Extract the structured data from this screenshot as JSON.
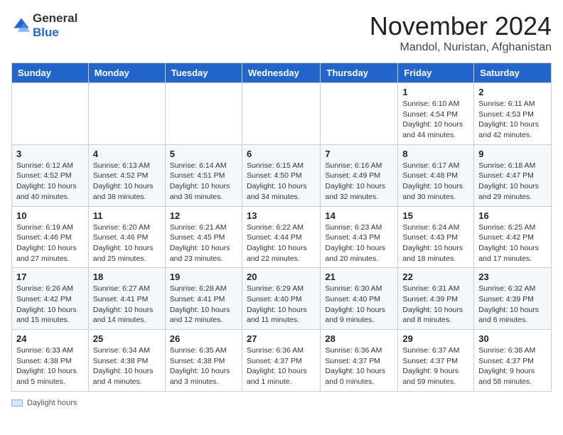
{
  "header": {
    "logo_general": "General",
    "logo_blue": "Blue",
    "month_title": "November 2024",
    "location": "Mandol, Nuristan, Afghanistan"
  },
  "columns": [
    "Sunday",
    "Monday",
    "Tuesday",
    "Wednesday",
    "Thursday",
    "Friday",
    "Saturday"
  ],
  "weeks": [
    [
      {
        "day": "",
        "info": ""
      },
      {
        "day": "",
        "info": ""
      },
      {
        "day": "",
        "info": ""
      },
      {
        "day": "",
        "info": ""
      },
      {
        "day": "",
        "info": ""
      },
      {
        "day": "1",
        "info": "Sunrise: 6:10 AM\nSunset: 4:54 PM\nDaylight: 10 hours and 44 minutes."
      },
      {
        "day": "2",
        "info": "Sunrise: 6:11 AM\nSunset: 4:53 PM\nDaylight: 10 hours and 42 minutes."
      }
    ],
    [
      {
        "day": "3",
        "info": "Sunrise: 6:12 AM\nSunset: 4:52 PM\nDaylight: 10 hours and 40 minutes."
      },
      {
        "day": "4",
        "info": "Sunrise: 6:13 AM\nSunset: 4:52 PM\nDaylight: 10 hours and 38 minutes."
      },
      {
        "day": "5",
        "info": "Sunrise: 6:14 AM\nSunset: 4:51 PM\nDaylight: 10 hours and 36 minutes."
      },
      {
        "day": "6",
        "info": "Sunrise: 6:15 AM\nSunset: 4:50 PM\nDaylight: 10 hours and 34 minutes."
      },
      {
        "day": "7",
        "info": "Sunrise: 6:16 AM\nSunset: 4:49 PM\nDaylight: 10 hours and 32 minutes."
      },
      {
        "day": "8",
        "info": "Sunrise: 6:17 AM\nSunset: 4:48 PM\nDaylight: 10 hours and 30 minutes."
      },
      {
        "day": "9",
        "info": "Sunrise: 6:18 AM\nSunset: 4:47 PM\nDaylight: 10 hours and 29 minutes."
      }
    ],
    [
      {
        "day": "10",
        "info": "Sunrise: 6:19 AM\nSunset: 4:46 PM\nDaylight: 10 hours and 27 minutes."
      },
      {
        "day": "11",
        "info": "Sunrise: 6:20 AM\nSunset: 4:46 PM\nDaylight: 10 hours and 25 minutes."
      },
      {
        "day": "12",
        "info": "Sunrise: 6:21 AM\nSunset: 4:45 PM\nDaylight: 10 hours and 23 minutes."
      },
      {
        "day": "13",
        "info": "Sunrise: 6:22 AM\nSunset: 4:44 PM\nDaylight: 10 hours and 22 minutes."
      },
      {
        "day": "14",
        "info": "Sunrise: 6:23 AM\nSunset: 4:43 PM\nDaylight: 10 hours and 20 minutes."
      },
      {
        "day": "15",
        "info": "Sunrise: 6:24 AM\nSunset: 4:43 PM\nDaylight: 10 hours and 18 minutes."
      },
      {
        "day": "16",
        "info": "Sunrise: 6:25 AM\nSunset: 4:42 PM\nDaylight: 10 hours and 17 minutes."
      }
    ],
    [
      {
        "day": "17",
        "info": "Sunrise: 6:26 AM\nSunset: 4:42 PM\nDaylight: 10 hours and 15 minutes."
      },
      {
        "day": "18",
        "info": "Sunrise: 6:27 AM\nSunset: 4:41 PM\nDaylight: 10 hours and 14 minutes."
      },
      {
        "day": "19",
        "info": "Sunrise: 6:28 AM\nSunset: 4:41 PM\nDaylight: 10 hours and 12 minutes."
      },
      {
        "day": "20",
        "info": "Sunrise: 6:29 AM\nSunset: 4:40 PM\nDaylight: 10 hours and 11 minutes."
      },
      {
        "day": "21",
        "info": "Sunrise: 6:30 AM\nSunset: 4:40 PM\nDaylight: 10 hours and 9 minutes."
      },
      {
        "day": "22",
        "info": "Sunrise: 6:31 AM\nSunset: 4:39 PM\nDaylight: 10 hours and 8 minutes."
      },
      {
        "day": "23",
        "info": "Sunrise: 6:32 AM\nSunset: 4:39 PM\nDaylight: 10 hours and 6 minutes."
      }
    ],
    [
      {
        "day": "24",
        "info": "Sunrise: 6:33 AM\nSunset: 4:38 PM\nDaylight: 10 hours and 5 minutes."
      },
      {
        "day": "25",
        "info": "Sunrise: 6:34 AM\nSunset: 4:38 PM\nDaylight: 10 hours and 4 minutes."
      },
      {
        "day": "26",
        "info": "Sunrise: 6:35 AM\nSunset: 4:38 PM\nDaylight: 10 hours and 3 minutes."
      },
      {
        "day": "27",
        "info": "Sunrise: 6:36 AM\nSunset: 4:37 PM\nDaylight: 10 hours and 1 minute."
      },
      {
        "day": "28",
        "info": "Sunrise: 6:36 AM\nSunset: 4:37 PM\nDaylight: 10 hours and 0 minutes."
      },
      {
        "day": "29",
        "info": "Sunrise: 6:37 AM\nSunset: 4:37 PM\nDaylight: 9 hours and 59 minutes."
      },
      {
        "day": "30",
        "info": "Sunrise: 6:38 AM\nSunset: 4:37 PM\nDaylight: 9 hours and 58 minutes."
      }
    ]
  ],
  "legend": {
    "box_label": "Daylight hours"
  }
}
